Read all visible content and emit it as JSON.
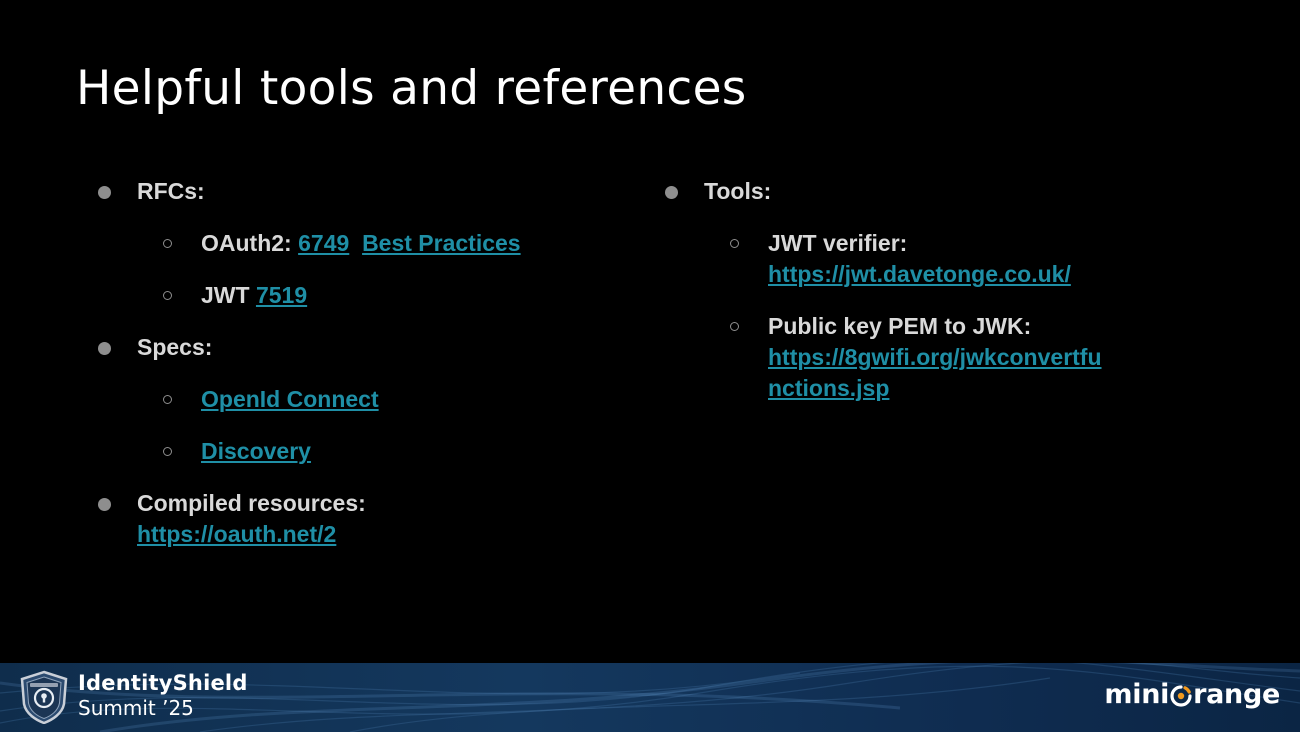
{
  "title": "Helpful tools and references",
  "left": {
    "rfcs_label": "RFCs:",
    "oauth2_label": "OAuth2:",
    "oauth2_link_rfc": "6749",
    "oauth2_link_bp": "Best Practices",
    "jwt_label": "JWT",
    "jwt_link": "7519",
    "specs_label": "Specs:",
    "openid_link": "OpenId Connect",
    "discovery_link": "Discovery",
    "compiled_label": "Compiled resources:",
    "compiled_link": "https://oauth.net/2"
  },
  "right": {
    "tools_label": "Tools:",
    "jwt_verifier_label": "JWT verifier:",
    "jwt_verifier_link": "https://jwt.davetonge.co.uk/",
    "pem_label": "Public key PEM to JWK:",
    "pem_link": "https://8gwifi.org/jwkconvertfunctions.jsp"
  },
  "footer": {
    "event_name": "IdentityShield",
    "event_year": "Summit ’25",
    "logo_left": "mini",
    "logo_right": "range"
  },
  "colors": {
    "background": "#000000",
    "title": "#ffffff",
    "body_text": "#d9d9d9",
    "link": "#1f8fa6",
    "bullet": "#8e8e8e",
    "footer": "#14385e",
    "logo_accent": "#f39a1e"
  }
}
